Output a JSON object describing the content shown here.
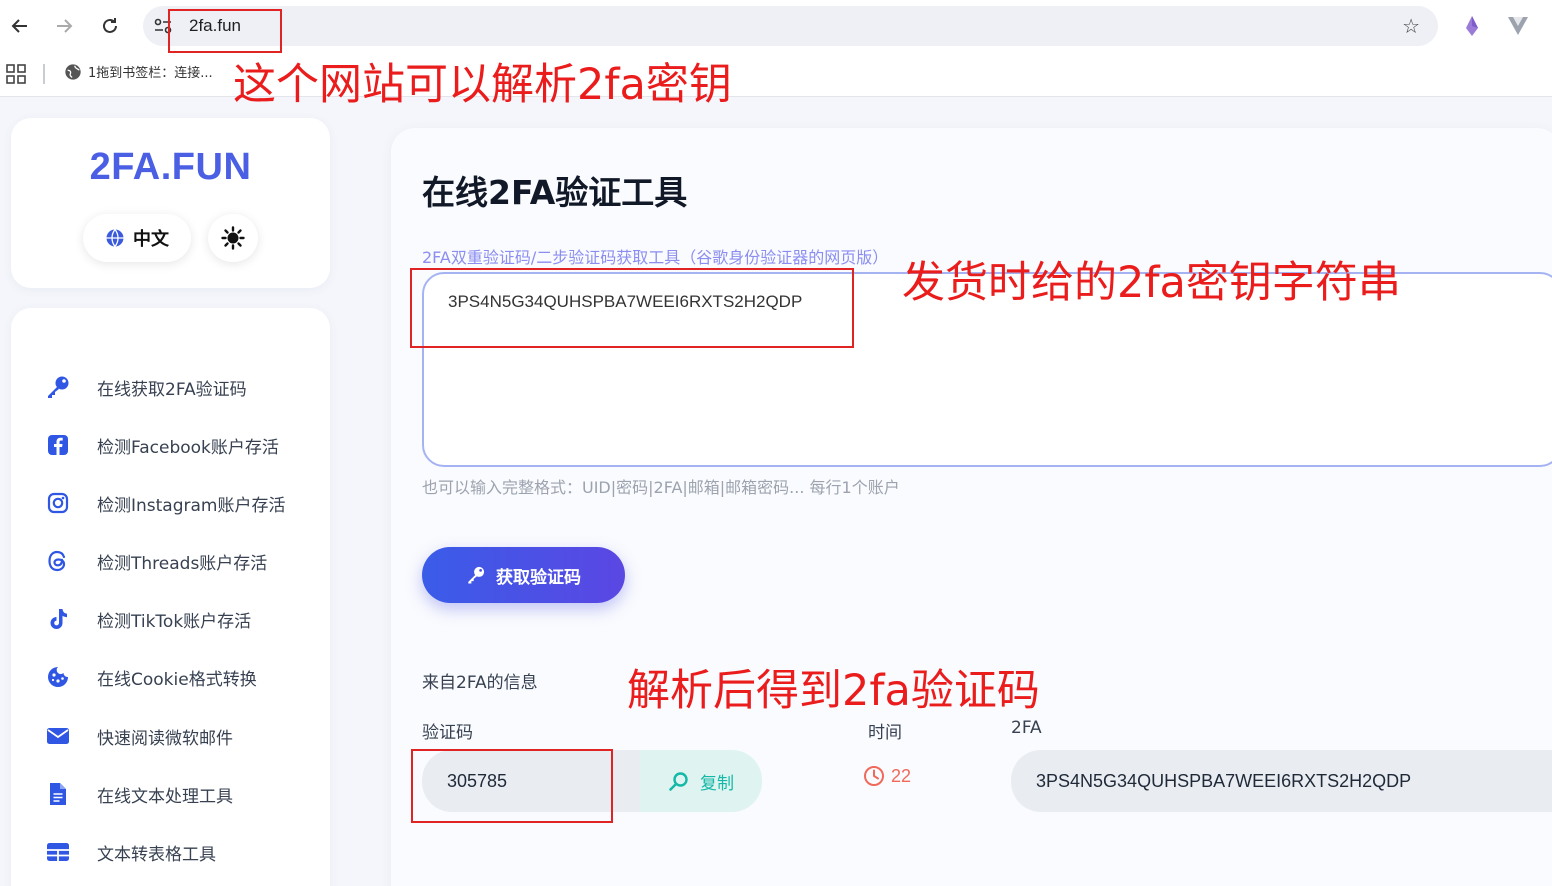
{
  "browser": {
    "url": "2fa.fun",
    "bookmark_label": "1拖到书签栏：连接..."
  },
  "sidebar": {
    "logo": "2FA.FUN",
    "lang_label": "中文",
    "menu": [
      {
        "label": "在线获取2FA验证码",
        "icon": "key-icon"
      },
      {
        "label": "检测Facebook账户存活",
        "icon": "facebook-icon"
      },
      {
        "label": "检测Instagram账户存活",
        "icon": "instagram-icon"
      },
      {
        "label": "检测Threads账户存活",
        "icon": "threads-icon"
      },
      {
        "label": "检测TikTok账户存活",
        "icon": "tiktok-icon"
      },
      {
        "label": "在线Cookie格式转换",
        "icon": "cookie-icon"
      },
      {
        "label": "快速阅读微软邮件",
        "icon": "envelope-icon"
      },
      {
        "label": "在线文本处理工具",
        "icon": "file-icon"
      },
      {
        "label": "文本转表格工具",
        "icon": "table-icon"
      }
    ]
  },
  "main": {
    "title": "在线2FA验证工具",
    "subtitle": "2FA双重验证码/二步验证码获取工具（谷歌身份验证器的网页版）",
    "secret_input": "3PS4N5G34QUHSPBA7WEEI6RXTS2H2QDP",
    "hint": "也可以输入完整格式：UID|密码|2FA|邮箱|邮箱密码... 每行1个账户",
    "get_button": "获取验证码",
    "info_label": "来自2FA的信息",
    "col_code": "验证码",
    "col_time": "时间",
    "col_2fa": "2FA",
    "code_value": "305785",
    "copy_label": "复制",
    "time_value": "22",
    "key_value": "3PS4N5G34QUHSPBA7WEEI6RXTS2H2QDP"
  },
  "annotations": {
    "a1": "这个网站可以解析2fa密钥",
    "a2": "发货时给的2fa密钥字符串",
    "a3": "解析后得到2fa验证码"
  },
  "colors": {
    "accent": "#4a5fe3",
    "annotation_red": "#ea1c1c",
    "copy_teal": "#14b8a6",
    "timer_red": "#ef6a5a"
  }
}
